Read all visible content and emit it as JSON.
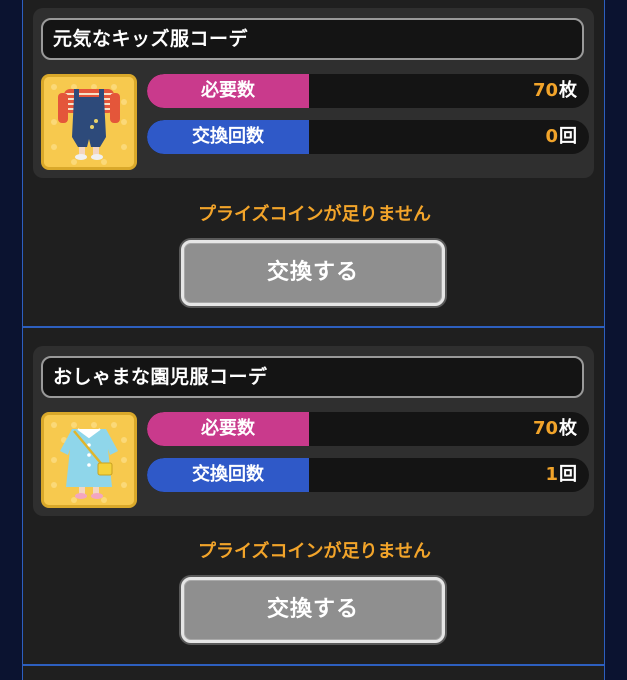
{
  "items": [
    {
      "title": "元気なキッズ服コーデ",
      "icon": "kids-outfit-overalls-icon",
      "required_label": "必要数",
      "required_value": "70",
      "required_unit": "枚",
      "exchange_label": "交換回数",
      "exchange_value": "0",
      "exchange_unit": "回",
      "warning": "プライズコインが足りません",
      "button_label": "交換する"
    },
    {
      "title": "おしゃまな園児服コーデ",
      "icon": "kindergarten-outfit-smock-icon",
      "required_label": "必要数",
      "required_value": "70",
      "required_unit": "枚",
      "exchange_label": "交換回数",
      "exchange_value": "1",
      "exchange_unit": "回",
      "warning": "プライズコインが足りません",
      "button_label": "交換する"
    }
  ],
  "colors": {
    "required_label_bg": "#c93a8c",
    "exchange_label_bg": "#2f59c8",
    "value_accent": "#f2a42a",
    "panel_border": "#2d5fbf",
    "button_bg": "#8f8f8f"
  }
}
